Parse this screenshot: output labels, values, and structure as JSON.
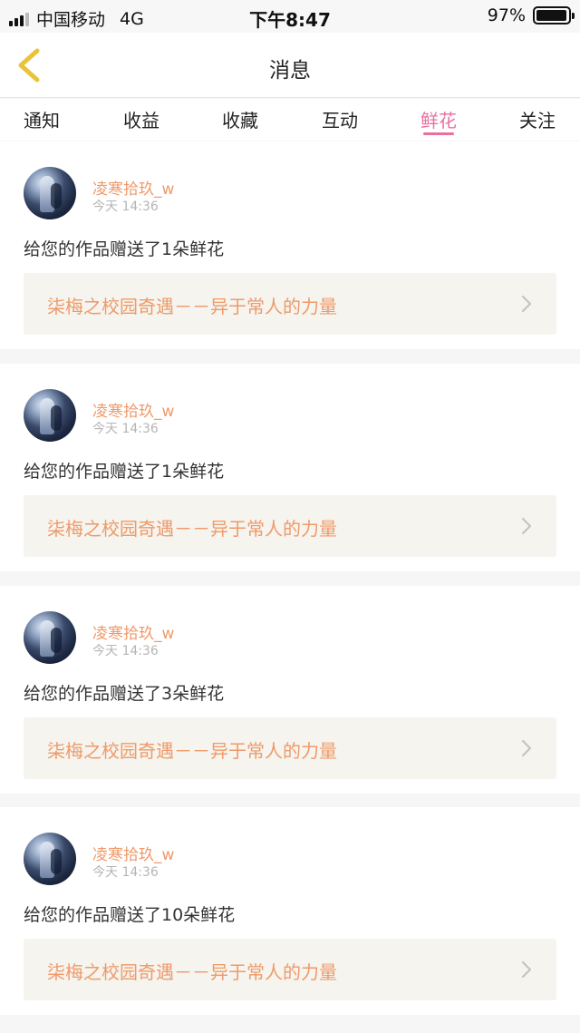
{
  "status_bar": {
    "carrier": "中国移动",
    "network": "4G",
    "time": "下午8:47",
    "battery": "97%",
    "battery_level": 0.97
  },
  "nav": {
    "title": "消息",
    "back_icon": "chevron-left-icon",
    "accent_color": "#e9c43b"
  },
  "tabs": [
    {
      "label": "通知",
      "active": false
    },
    {
      "label": "收益",
      "active": false
    },
    {
      "label": "收藏",
      "active": false
    },
    {
      "label": "互动",
      "active": false
    },
    {
      "label": "鲜花",
      "active": true
    },
    {
      "label": "关注",
      "active": false
    }
  ],
  "active_tab_color": "#ec6fa0",
  "messages": [
    {
      "user": "凌寒拾玖_w",
      "time": "今天 14:36",
      "text": "给您的作品赠送了1朵鲜花",
      "work": "柒梅之校园奇遇－－异于常人的力量"
    },
    {
      "user": "凌寒拾玖_w",
      "time": "今天 14:36",
      "text": "给您的作品赠送了1朵鲜花",
      "work": "柒梅之校园奇遇－－异于常人的力量"
    },
    {
      "user": "凌寒拾玖_w",
      "time": "今天 14:36",
      "text": "给您的作品赠送了3朵鲜花",
      "work": "柒梅之校园奇遇－－异于常人的力量"
    },
    {
      "user": "凌寒拾玖_w",
      "time": "今天 14:36",
      "text": "给您的作品赠送了10朵鲜花",
      "work": "柒梅之校园奇遇－－异于常人的力量"
    }
  ]
}
